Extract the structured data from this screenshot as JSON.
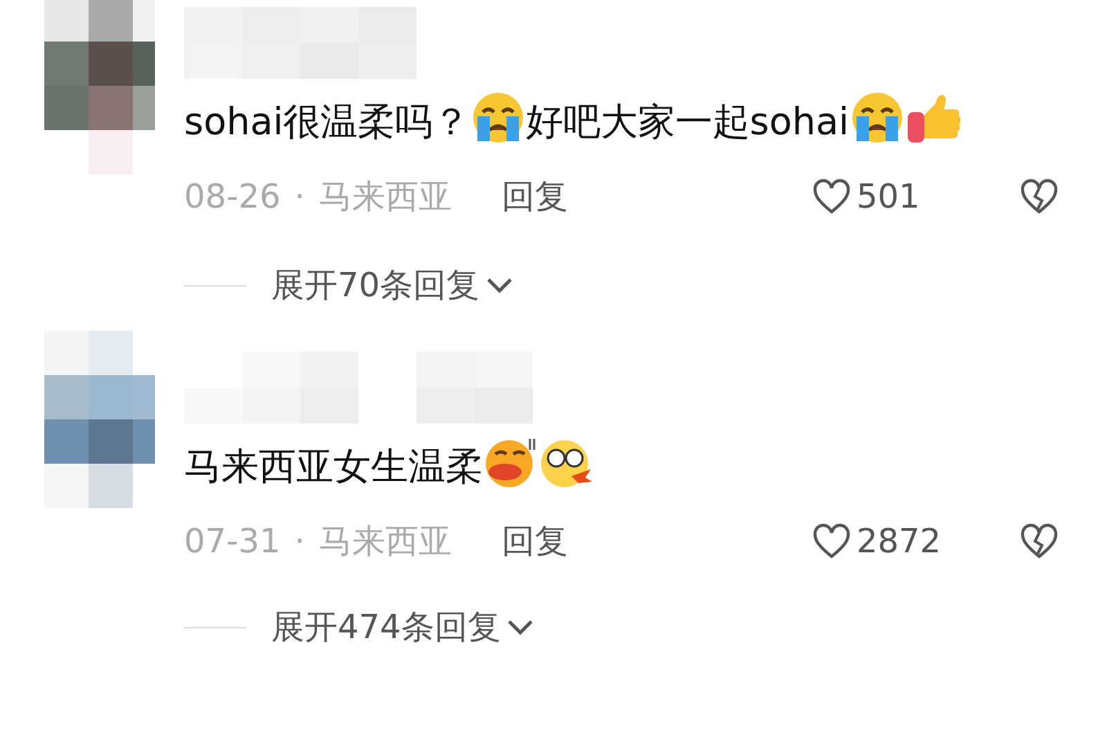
{
  "comments": [
    {
      "content": [
        {
          "kind": "text",
          "text": "sohai很温柔吗？"
        },
        {
          "kind": "crying"
        },
        {
          "kind": "text",
          "text": "好吧大家一起sohai"
        },
        {
          "kind": "crying"
        },
        {
          "kind": "thumbs"
        }
      ],
      "date": "08-26",
      "separator": "·",
      "location": "马来西亚",
      "reply": "回复",
      "likes": "501",
      "expand": "展开70条回复"
    },
    {
      "content": [
        {
          "kind": "text",
          "text": "马来西亚女生温柔"
        },
        {
          "kind": "smug"
        },
        {
          "kind": "shocked"
        }
      ],
      "date": "07-31",
      "separator": "·",
      "location": "马来西亚",
      "reply": "回复",
      "likes": "2872",
      "expand": "展开474条回复"
    }
  ]
}
